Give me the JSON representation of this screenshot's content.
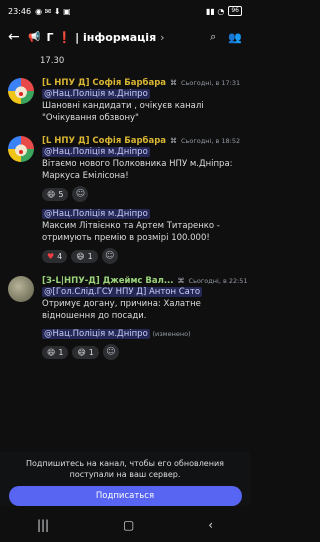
{
  "status": {
    "time": "23:46",
    "battery": "96"
  },
  "header": {
    "title_part1": "Г",
    "title_bang": "❗",
    "title_part2": "|  інформація"
  },
  "partial_message": "17.30",
  "messages": [
    {
      "author": "[L НПУ Д] Софія Барбара",
      "time": "Сьогодні, в 17:31",
      "mention": "@Нац.Поліція м.Дніпро",
      "lines": [
        "Шановні кандидати , очікуєв каналі",
        "\"Очікування обзвону\""
      ]
    },
    {
      "author": "[L НПУ Д] Софія Барбара",
      "time": "Сьогодні, в 18:52",
      "mention": "@Нац.Поліція м.Дніпро",
      "lines": [
        "Вітаємо нового Полковника НПУ м.Дніпра:",
        "Маркуса Емілісона!"
      ],
      "reaction1_count": "5",
      "mention2": "@Нац.Поліція м.Дніпро",
      "lines2": [
        "Максим Літвієнко та Артем Титаренко -",
        "отримують премію в розмірі 100.000!"
      ],
      "reaction2_count": "4",
      "reaction3_count": "1"
    },
    {
      "author": "[З-L|НПУ-Д] Джеймс Вал...",
      "time": "Сьогодні, в 22:51",
      "mention": "@[Гол.Слід.ГСУ НПУ Д] Антон Сато",
      "lines": [
        "Отримує догану, причина: Халатне",
        "відношення до посади."
      ],
      "mention2": "@Нац.Поліція м.Дніпро",
      "edited": "(изменено)",
      "reaction1_count": "1",
      "reaction2_count": "1"
    }
  ],
  "footer": {
    "note": "Подпишитесь на канал, чтобы его обновления поступали на ваш сервер.",
    "button": "Подписаться"
  }
}
